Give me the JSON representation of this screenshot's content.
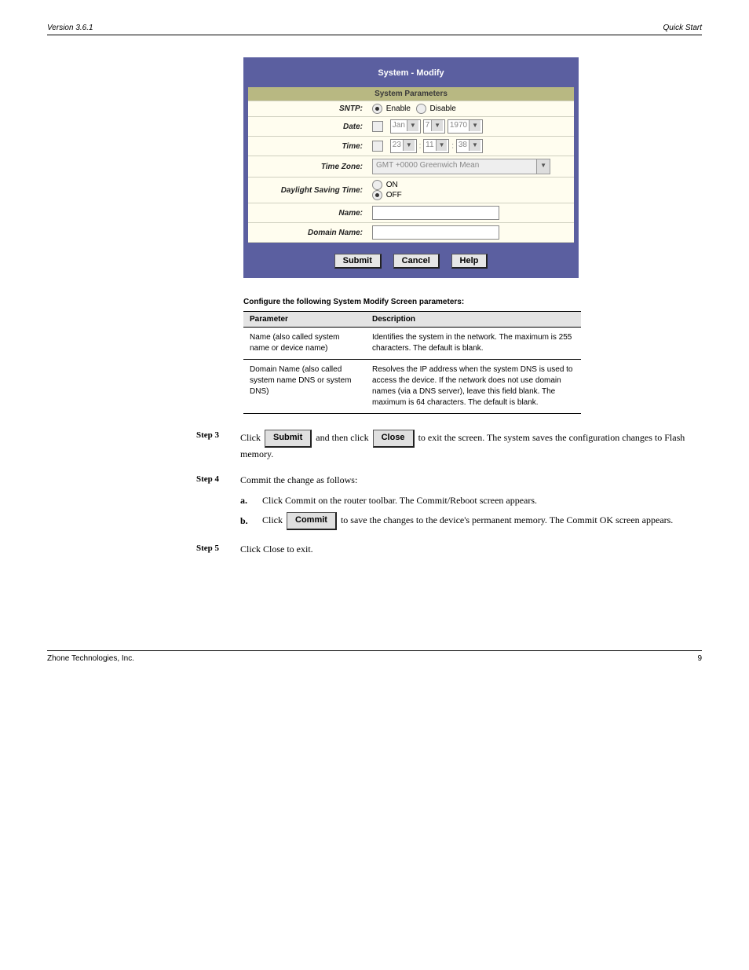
{
  "header": {
    "left": "Version 3.6.1",
    "right": "Quick Start"
  },
  "panel": {
    "title": "System - Modify",
    "sectionHeader": "System Parameters",
    "rows": {
      "sntp": {
        "label": "SNTP:",
        "enable": "Enable",
        "disable": "Disable"
      },
      "date": {
        "label": "Date:",
        "month": "Jan",
        "day": "7",
        "year": "1970"
      },
      "time": {
        "label": "Time:",
        "hh": "23",
        "mm": "11",
        "ss": "38"
      },
      "timezone": {
        "label": "Time Zone:",
        "value": "GMT +0000 Greenwich Mean"
      },
      "dst": {
        "label": "Daylight Saving Time:",
        "on": "ON",
        "off": "OFF"
      },
      "name": {
        "label": "Name:"
      },
      "domain": {
        "label": "Domain Name:"
      }
    },
    "buttons": {
      "submit": "Submit",
      "cancel": "Cancel",
      "help": "Help"
    }
  },
  "paramsSection": {
    "intro": "Configure the following System Modify Screen parameters:",
    "cols": {
      "param": "Parameter",
      "desc": "Description"
    },
    "rows": [
      {
        "param": "Name (also called system name or device name)",
        "desc": "Identifies the system in the network. The maximum is 255 characters. The default is blank."
      },
      {
        "param": "Domain Name (also called system name DNS or system DNS)",
        "desc": "Resolves the IP address when the system DNS is used to access the device. If the network does not use domain names (via a DNS server), leave this field blank. The maximum is 64 characters. The default is blank."
      }
    ]
  },
  "steps": {
    "step3": {
      "num": "Step 3",
      "text_pre": "Click ",
      "btn1": "Submit",
      "text_mid": " and then click ",
      "btn2": "Close",
      "text_post": " to exit the screen. The system saves the configuration changes to Flash memory."
    },
    "step4": {
      "num": "Step 4",
      "text": "Commit the change as follows:",
      "sub_a_label": "a.",
      "sub_a_text": "Click Commit on the router toolbar. The Commit/Reboot screen appears.",
      "sub_b_label": "b.",
      "sub_b_btn": "Commit",
      "sub_b_text_pre": "Click ",
      "sub_b_text_post": " to save the changes to the device's permanent memory. The Commit OK screen appears."
    },
    "step5": {
      "num": "Step 5",
      "text": "Click Close to exit."
    }
  },
  "footer": {
    "left": "Zhone Technologies, Inc.",
    "right": "9"
  }
}
